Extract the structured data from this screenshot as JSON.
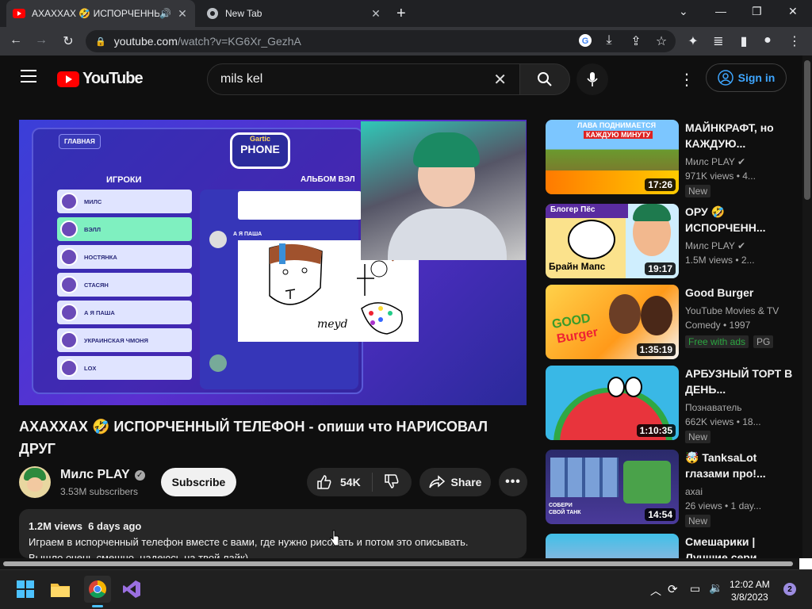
{
  "browser": {
    "tabs": [
      {
        "title": "АХАХХАХ 🤣 ИСПОРЧЕННЫЙ ТЕЛЕФОН"
      },
      {
        "title": "New Tab"
      }
    ],
    "url_host": "youtube.com",
    "url_path": "/watch?v=KG6Xr_GezhA"
  },
  "youtube": {
    "logo_text": "YouTube",
    "search_query": "mils kel",
    "signin_label": "Sign in"
  },
  "video": {
    "title": "АХАХХАХ 🤣 ИСПОРЧЕННЫЙ ТЕЛЕФОН - опиши что НАРИСОВАЛ ДРУГ",
    "channel_name": "Милс PLAY",
    "subscribers": "3.53M subscribers",
    "subscribe_label": "Subscribe",
    "likes": "54K",
    "share_label": "Share",
    "views": "1.2M views",
    "age": "6 days ago",
    "description_line1": "Играем в испорченный телефон вместе с вами, где нужно рисовать и потом это описывать.",
    "description_line2": "Вышло очень смешно, надеюсь на твой лайк)"
  },
  "game_overlay": {
    "home_label": "ГЛАВНАЯ",
    "logo_line1": "Gartic",
    "logo_line2": "PHONE",
    "players_header": "ИГРОКИ",
    "album_header": "АЛЬБОМ ВЭЛ",
    "players": [
      "МИЛС",
      "ВЭЛЛ",
      "НОСТЯНКА",
      "СТАСЯН",
      "А Я ПАША",
      "УКРАИНСКАЯ ЧМОНЯ",
      "LOX"
    ],
    "chat_author": "А Я ПАША",
    "drawing_text": "meyd"
  },
  "recommendations": [
    {
      "title": "МАЙНКРАФТ, но КАЖДУЮ...",
      "channel": "Милс PLAY",
      "meta": "971K views • 4...",
      "duration": "17:26",
      "badge": "New",
      "thumb_caption1": "ЛАВА ПОДНИМАЕТСЯ",
      "thumb_caption2": "КАЖДУЮ МИНУТУ"
    },
    {
      "title": "ОРУ 🤣 ИСПОРЧЕНН...",
      "channel": "Милс PLAY",
      "meta": "1.5M views • 2...",
      "duration": "19:17",
      "badge": "",
      "thumb_caption1": "Блогер Пёс",
      "thumb_caption2": "Брайн Мапс"
    },
    {
      "title": "Good Burger",
      "channel": "YouTube Movies & TV",
      "meta": "Comedy • 1997",
      "duration": "1:35:19",
      "badge": "PG",
      "badge2": "Free with ads",
      "thumb_caption1": "GOOD",
      "thumb_caption2": "Burger"
    },
    {
      "title": "АРБУЗНЫЙ ТОРТ В ДЕНЬ...",
      "channel": "Познаватель",
      "meta": "662K views • 18...",
      "duration": "1:10:35",
      "badge": "New"
    },
    {
      "title": "🤯 TanksaLot глазами про!...",
      "channel": "axai",
      "meta": "26 views • 1 day...",
      "duration": "14:54",
      "badge": "New",
      "thumb_caption1": "СОБЕРИ СВОЙ ТАНК"
    },
    {
      "title": "Смешарики | Лучшие сери..."
    }
  ],
  "taskbar": {
    "time": "12:02 AM",
    "date": "3/8/2023",
    "notification_count": "2"
  },
  "colors": {
    "yt_red": "#ff0000",
    "link_blue": "#3ea6ff",
    "free_green": "#2ba640"
  }
}
